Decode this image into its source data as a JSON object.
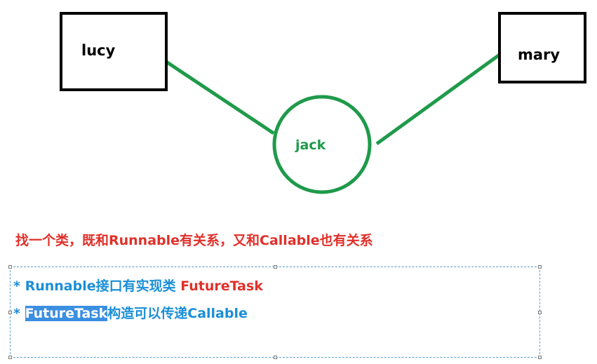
{
  "nodes": {
    "lucy": {
      "label": "lucy"
    },
    "mary": {
      "label": "mary"
    },
    "jack": {
      "label": "jack"
    }
  },
  "colors": {
    "box_border": "#000000",
    "circle": "#1f9a4a",
    "edge": "#1f9a4a",
    "red_text": "#e0302a",
    "blue_text": "#1a8fd6",
    "highlight": "#3b8fe0",
    "selection_border": "#5a9ec4"
  },
  "caption": "找一个类，既和Runnable有关系，又和Callable也有关系",
  "notes": {
    "line1": {
      "bullet": "* ",
      "text": "Runnable接口有实现类 ",
      "class_name": "FutureTask"
    },
    "line2": {
      "bullet": "* ",
      "highlighted": "FutureTask",
      "text": "构造可以传递Callable"
    }
  }
}
